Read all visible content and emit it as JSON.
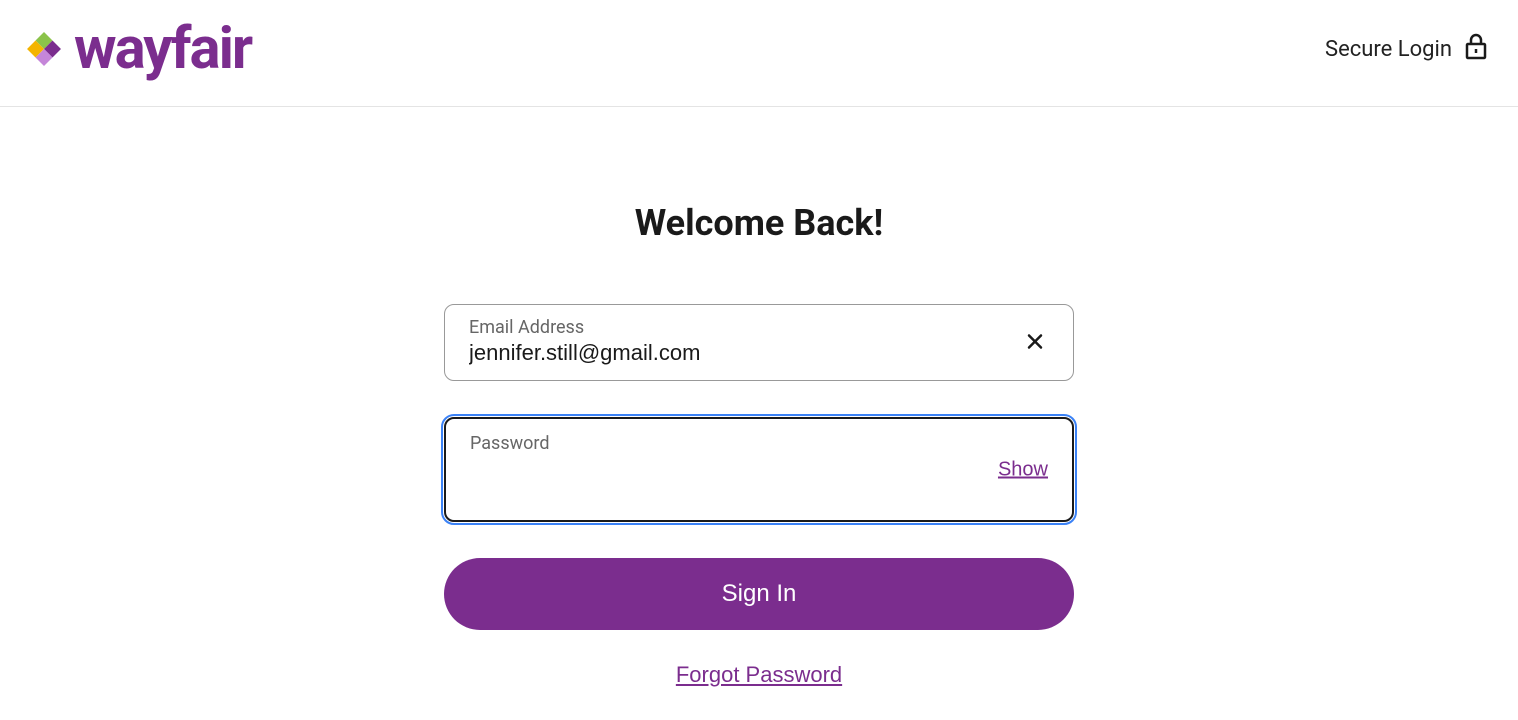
{
  "header": {
    "brand_name": "wayfair",
    "secure_login_label": "Secure Login"
  },
  "main": {
    "title": "Welcome Back!",
    "email": {
      "label": "Email Address",
      "value": "jennifer.still@gmail.com"
    },
    "password": {
      "label": "Password",
      "value": "",
      "show_label": "Show"
    },
    "sign_in_label": "Sign In",
    "forgot_password_label": "Forgot Password"
  },
  "colors": {
    "brand_purple": "#7b2d8e",
    "text_dark": "#1a1a1a",
    "text_muted": "#666"
  }
}
